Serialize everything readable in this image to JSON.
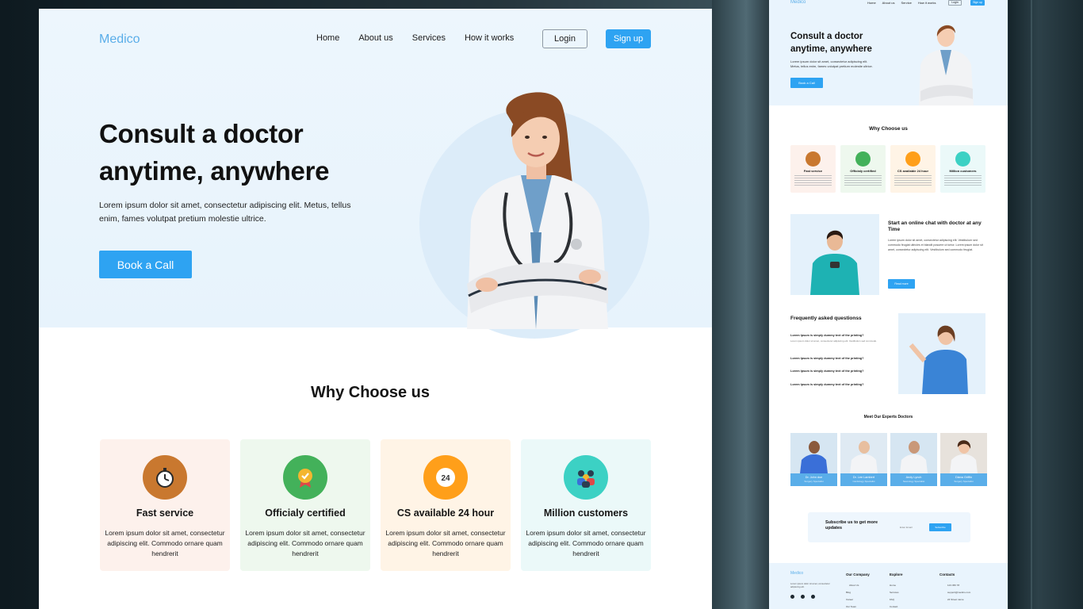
{
  "brand": {
    "name": "Medico",
    "accent": "#2ea3f2",
    "logo_color": "#5aaee9"
  },
  "nav": {
    "items": [
      "Home",
      "About us",
      "Services",
      "How it works"
    ],
    "login": "Login",
    "signup": "Sign up"
  },
  "hero": {
    "title": "Consult a doctor anytime, anywhere",
    "subtitle": "Lorem ipsum dolor sit amet, consectetur adipiscing elit. Metus, tellus enim, fames volutpat pretium molestie ultrice.",
    "cta": "Book a Call"
  },
  "why": {
    "title": "Why Choose us",
    "cards": [
      {
        "title": "Fast service",
        "desc": "Lorem ipsum dolor sit amet, consectetur adipiscing elit. Commodo ornare quam hendrerit",
        "icon": "stopwatch-icon",
        "bg": "#fdf1ec",
        "icon_bg": "#c9782f"
      },
      {
        "title": "Officialy certified",
        "desc": "Lorem ipsum dolor sit amet, consectetur adipiscing elit. Commodo ornare quam hendrerit",
        "icon": "certificate-badge-icon",
        "bg": "#eef8ee",
        "icon_bg": "#43b15a"
      },
      {
        "title": "CS available 24 hour",
        "desc": "Lorem ipsum dolor sit amet, consectetur adipiscing elit. Commodo ornare quam hendrerit",
        "icon": "clock-24-icon",
        "bg": "#fff4e6",
        "icon_bg": "#ff9f1a"
      },
      {
        "title": "Million customers",
        "desc": "Lorem ipsum dolor sit amet, consectetur adipiscing elit. Commodo ornare quam hendrerit",
        "icon": "customers-group-icon",
        "bg": "#ebf9f9",
        "icon_bg": "#3cd1c4"
      }
    ]
  },
  "preview": {
    "nav_items": [
      "Home",
      "About us",
      "Service",
      "How it works"
    ],
    "why_cards": [
      "Fast service",
      "Officialy certified",
      "CS available 24 hour",
      "Million customers"
    ],
    "chat": {
      "title": "Start an online chat with doctor at any Time",
      "text": "Lorem ipsum dolor sit amet, consectetur adipiscing elit. Vestibulum sed commodo feugiat ultricies et blandit posuere ut tortor. Lorem ipsum dolor sit amet, consectetur adipiscing elit. Vestibulum sed commodo feugiat.",
      "button": "Read more"
    },
    "faq": {
      "title": "Frequently asked questionss",
      "questions": [
        "Lorem Ipsum is simply dummy text of the printing?",
        "Lorem Ipsum is simply dummy text of the printing?",
        "Lorem Ipsum is simply dummy text of the printing?",
        "Lorem Ipsum is simply dummy text of the printing?"
      ],
      "answer": "Lorem ipsum dolor sit amet, consectetur adipiscing elit. Vestibulum sed commodo."
    },
    "experts": {
      "title": "Meet Our Experts Doctors",
      "doctors": [
        {
          "name": "Dr. John doe",
          "role": "Surgery Specialist"
        },
        {
          "name": "Dr. Lee Lambert",
          "role": "Cardiology Specialist"
        },
        {
          "name": "Andy Lynch",
          "role": "Neurology Specialist"
        },
        {
          "name": "Diana Griffin",
          "role": "Surgery Specialist"
        }
      ]
    },
    "subscribe": {
      "title": "Subscribe us to get more updates",
      "placeholder": "Enter Email",
      "button": "Subscribe"
    },
    "footer": {
      "logo": "Medico",
      "desc": "Lorem ipsum dolor sit amet, consectetur adipiscing elit.",
      "columns": [
        {
          "title": "Our Company",
          "items": [
            "About Us",
            "Blog",
            "Career",
            "Our Team"
          ]
        },
        {
          "title": "Explore",
          "items": [
            "Home",
            "Services",
            "FAQ",
            "Contact"
          ]
        },
        {
          "title": "Contacts",
          "items": [
            "123 456 78",
            "support@medico.com",
            "24 Street name"
          ]
        }
      ]
    }
  }
}
